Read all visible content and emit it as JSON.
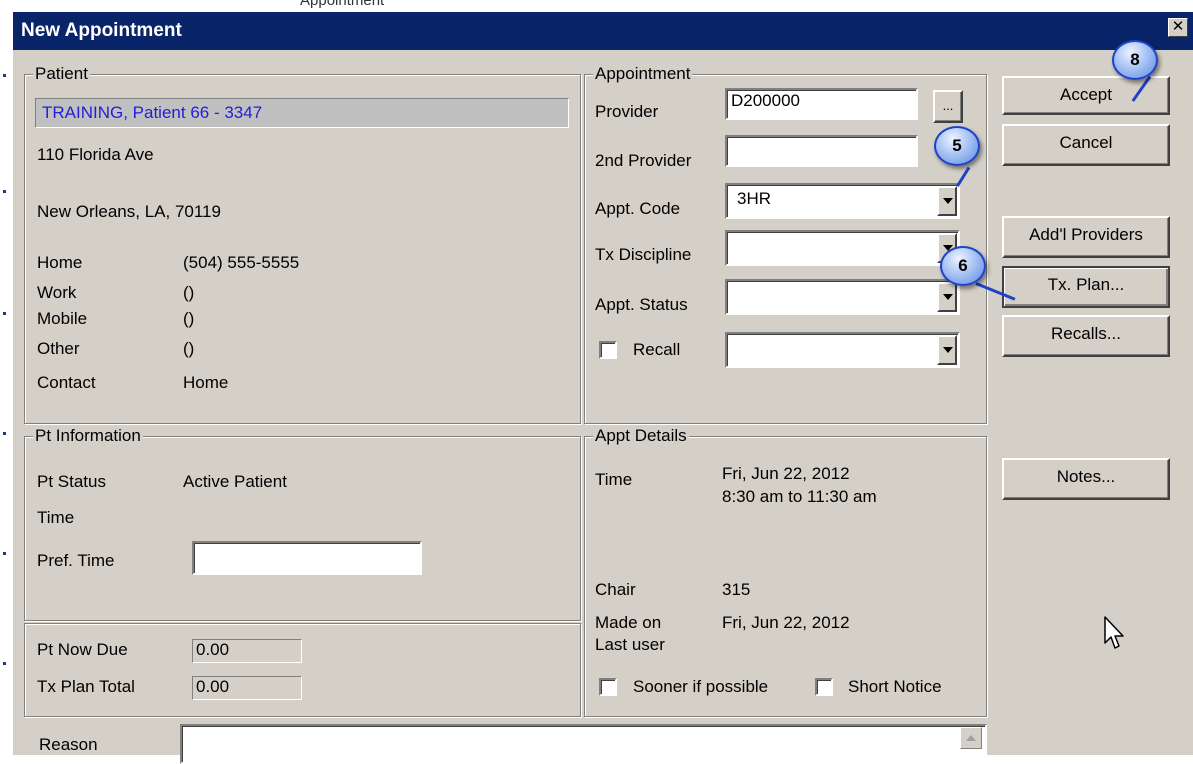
{
  "top_strip_text": "Appointment",
  "window": {
    "title": "New Appointment",
    "close_label": "✕"
  },
  "patient": {
    "legend": "Patient",
    "name": "TRAINING, Patient 66  - 3347",
    "address1": "110 Florida Ave",
    "address2": "New Orleans, LA, 70119",
    "phones": [
      {
        "label": "Home",
        "value": "(504) 555-5555"
      },
      {
        "label": "Work",
        "value": "()"
      },
      {
        "label": "Mobile",
        "value": "()"
      },
      {
        "label": "Other",
        "value": "()"
      },
      {
        "label": "Contact",
        "value": "Home"
      }
    ]
  },
  "appointment": {
    "legend": "Appointment",
    "provider_label": "Provider",
    "provider_value": "D200000",
    "ellipsis": "...",
    "second_provider_label": "2nd Provider",
    "second_provider_value": "",
    "appt_code_label": "Appt. Code",
    "appt_code_value": "3HR",
    "tx_discipline_label": "Tx Discipline",
    "tx_discipline_value": "",
    "appt_status_label": "Appt. Status",
    "appt_status_value": "",
    "recall_label": "Recall",
    "recall_value": ""
  },
  "buttons": {
    "accept": "Accept",
    "cancel": "Cancel",
    "addl_providers": "Add'l Providers",
    "tx_plan": "Tx. Plan...",
    "recalls": "Recalls...",
    "notes": "Notes..."
  },
  "pt_info": {
    "legend": "Pt Information",
    "status_label": "Pt Status",
    "status_value": "Active Patient",
    "time_label": "Time",
    "pref_time_label": "Pref. Time",
    "pref_time_value": ""
  },
  "pt_due": {
    "now_due_label": "Pt Now Due",
    "now_due_value": "0.00",
    "tx_plan_total_label": "Tx Plan Total",
    "tx_plan_total_value": "0.00"
  },
  "appt_details": {
    "legend": "Appt Details",
    "time_label": "Time",
    "date": "Fri, Jun 22, 2012",
    "time_range": "8:30 am to 11:30 am",
    "chair_label": "Chair",
    "chair_value": "315",
    "made_on_label": "Made on",
    "made_on_value": "Fri, Jun 22, 2012",
    "last_user_label": "Last user",
    "sooner_label": "Sooner if possible",
    "short_notice_label": "Short Notice"
  },
  "reason": {
    "label": "Reason",
    "value": ""
  },
  "callouts": [
    "8",
    "5",
    "6"
  ]
}
